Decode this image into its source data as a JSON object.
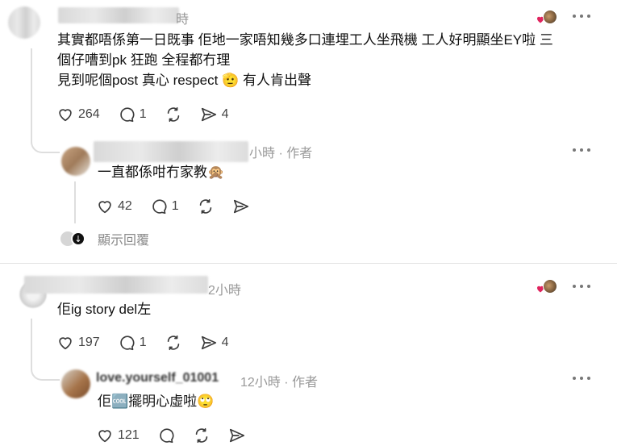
{
  "comment1": {
    "time_suffix": "時",
    "body_lines": [
      "其實都唔係第一日既事 佢地一家唔知幾多口連埋工人坐飛機 工人好明顯坐EY啦 三",
      "個仔嘈到pk 狂跑 全程都冇理",
      "見到呢個post 真心 respect 🫡 有人肯出聲"
    ],
    "likes": "264",
    "replies": "1",
    "reposts": "",
    "shares": "4"
  },
  "reply1": {
    "time": "小時",
    "separator": "·",
    "author_tag": "作者",
    "body": "一直都係咁冇家教🙊",
    "likes": "42",
    "replies": "1"
  },
  "show_replies": {
    "label": "顯示回覆"
  },
  "comment2": {
    "time": "2小時",
    "body": "佢ig story del左",
    "likes": "197",
    "replies": "1",
    "shares": "4"
  },
  "reply2": {
    "username": "love.yourself_01001",
    "time": "12小時",
    "separator": "·",
    "author_tag": "作者",
    "body": "佢🆒擺明心虛啦🙄",
    "likes": "121"
  },
  "colors": {
    "heart_badge": "#e0245e",
    "icon_stroke": "#3a3a3a",
    "meta_text": "#999999"
  }
}
